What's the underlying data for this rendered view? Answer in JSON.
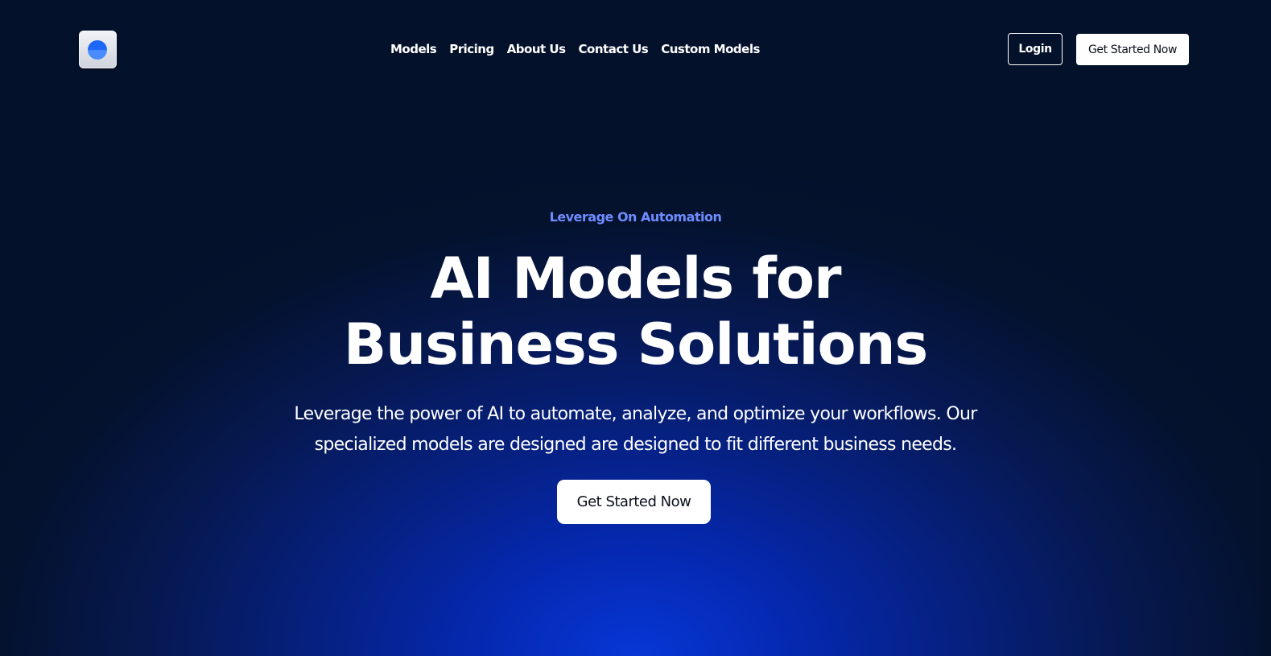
{
  "colors": {
    "background_dark": "#04112b",
    "background_glow": "#0737d6",
    "accent_eyebrow": "#6f8cff",
    "text_primary": "#ffffff",
    "button_bg": "#ffffff",
    "button_text": "#0b0f1a",
    "logo_mark": "#1e66f5"
  },
  "header": {
    "logo_icon": "brand-logo-icon",
    "nav": [
      {
        "label": "Models"
      },
      {
        "label": "Pricing"
      },
      {
        "label": "About Us"
      },
      {
        "label": "Contact Us"
      },
      {
        "label": "Custom Models"
      }
    ],
    "login_label": "Login",
    "cta_label": "Get Started Now"
  },
  "hero": {
    "eyebrow": "Leverage On Automation",
    "headline_line1": "AI Models for",
    "headline_line2": "Business Solutions",
    "description": "Leverage the power of AI to automate, analyze, and optimize your workflows. Our specialized models are designed are designed to fit different business needs.",
    "cta_label": "Get Started Now"
  }
}
